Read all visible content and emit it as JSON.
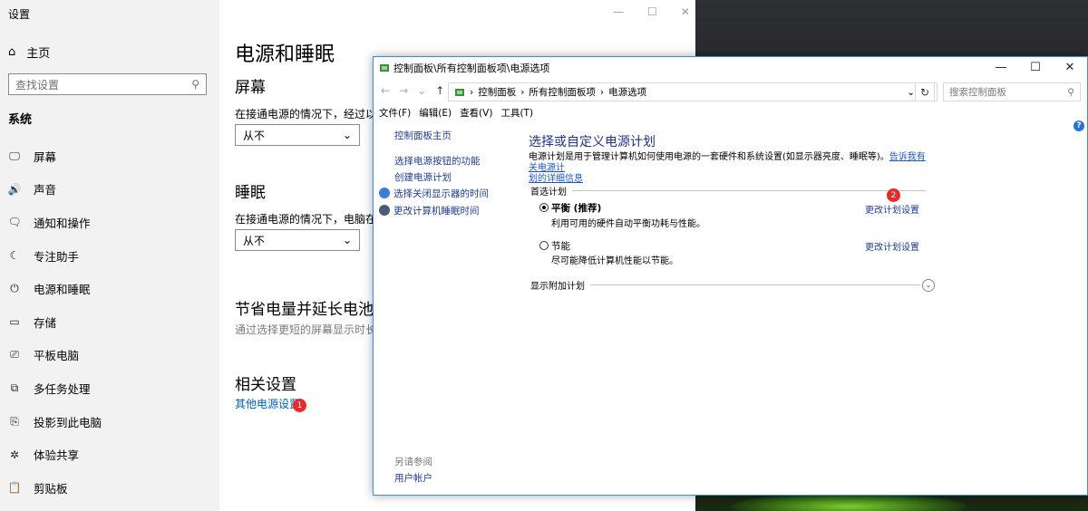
{
  "settings": {
    "title": "设置",
    "home": "主页",
    "search_placeholder": "查找设置",
    "section": "系统",
    "nav": [
      {
        "icon": "monitor-icon",
        "glyph": "🖵",
        "label": "屏幕"
      },
      {
        "icon": "speaker-icon",
        "glyph": "🔊",
        "label": "声音"
      },
      {
        "icon": "notification-icon",
        "glyph": "🗨",
        "label": "通知和操作"
      },
      {
        "icon": "moon-icon",
        "glyph": "☾",
        "label": "专注助手"
      },
      {
        "icon": "power-icon",
        "glyph": "⏻",
        "label": "电源和睡眠"
      },
      {
        "icon": "storage-icon",
        "glyph": "▭",
        "label": "存储"
      },
      {
        "icon": "tablet-icon",
        "glyph": "⎚",
        "label": "平板电脑"
      },
      {
        "icon": "multitask-icon",
        "glyph": "⧉",
        "label": "多任务处理"
      },
      {
        "icon": "project-icon",
        "glyph": "⎘",
        "label": "投影到此电脑"
      },
      {
        "icon": "share-icon",
        "glyph": "✲",
        "label": "体验共享"
      },
      {
        "icon": "clipboard-icon",
        "glyph": "📋",
        "label": "剪贴板"
      }
    ],
    "page_title": "电源和睡眠",
    "screen_heading": "屏幕",
    "screen_text": "在接通电源的情况下，经过以下时",
    "screen_value": "从不",
    "sleep_heading": "睡眠",
    "sleep_text": "在接通电源的情况下，电脑在经过",
    "sleep_value": "从不",
    "battery_heading": "节省电量并延长电池使",
    "battery_text": "通过选择更短的屏幕显示时长和睡",
    "related_heading": "相关设置",
    "related_link": "其他电源设置",
    "badge1": "1"
  },
  "cp": {
    "title": "控制面板\\所有控制面板项\\电源选项",
    "breadcrumb": [
      "控制面板",
      "所有控制面板项",
      "电源选项"
    ],
    "search_placeholder": "搜索控制面板",
    "menu": [
      "文件(F)",
      "编辑(E)",
      "查看(V)",
      "工具(T)"
    ],
    "left_links": {
      "home": "控制面板主页",
      "power_buttons": "选择电源按钮的功能",
      "create_plan": "创建电源计划",
      "display_off": "选择关闭显示器的时间",
      "sleep_time": "更改计算机睡眠时间"
    },
    "see_also": "另请参阅",
    "user_accounts": "用户帐户",
    "heading": "选择或自定义电源计划",
    "desc_text": "电源计划是用于管理计算机如何使用电源的一套硬件和系统设置(如显示器亮度、睡眠等)。",
    "desc_link_1": "告诉我有关电源计",
    "desc_link_2": "划的详细信息",
    "preferred": "首选计划",
    "plans": [
      {
        "name": "平衡 (推荐)",
        "desc": "利用可用的硬件自动平衡功耗与性能。",
        "change": "更改计划设置",
        "selected": true
      },
      {
        "name": "节能",
        "desc": "尽可能降低计算机性能以节能。",
        "change": "更改计划设置",
        "selected": false
      }
    ],
    "show_more": "显示附加计划",
    "badge2": "2"
  }
}
